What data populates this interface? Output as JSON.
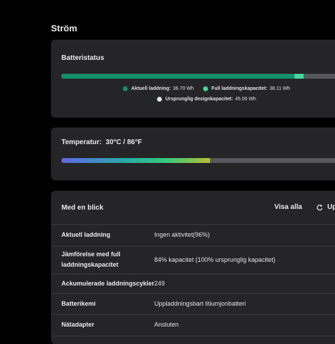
{
  "page": {
    "title": "Ström"
  },
  "battery": {
    "title": "Batteristatus",
    "legend": {
      "current": {
        "label": "Aktuell laddning:",
        "value": "36.70 Wh",
        "color": "#13906a"
      },
      "full": {
        "label": "Full laddningskapacitet:",
        "value": "38.11 Wh",
        "color": "#47d79a"
      },
      "design": {
        "label": "Ursprunglig designkapacitet:",
        "value": "45.00 Wh",
        "color": "#dde6ee"
      }
    },
    "current_wh": 36.7,
    "full_wh": 38.11,
    "design_wh": 45.0
  },
  "temperature": {
    "label": "Temperatur:",
    "value": "30°C / 86°F",
    "level_fraction": 0.52
  },
  "glance": {
    "title": "Med en blick",
    "view_all": "Visa alla",
    "update": "Up",
    "rows": [
      {
        "label": "Aktuell laddning",
        "value": "Ingen aktivitet(96%)"
      },
      {
        "label": "Jämförelse med full laddningskapacitet",
        "value": "84% kapacitet (100% ursprunglig kapacitet)"
      },
      {
        "label": "Ackumulerade laddningscykler",
        "value": "249"
      },
      {
        "label": "Batterikemi",
        "value": "Uppladdningsbart litiumjonbatteri"
      },
      {
        "label": "Nätadapter",
        "value": "Ansluten"
      }
    ]
  }
}
